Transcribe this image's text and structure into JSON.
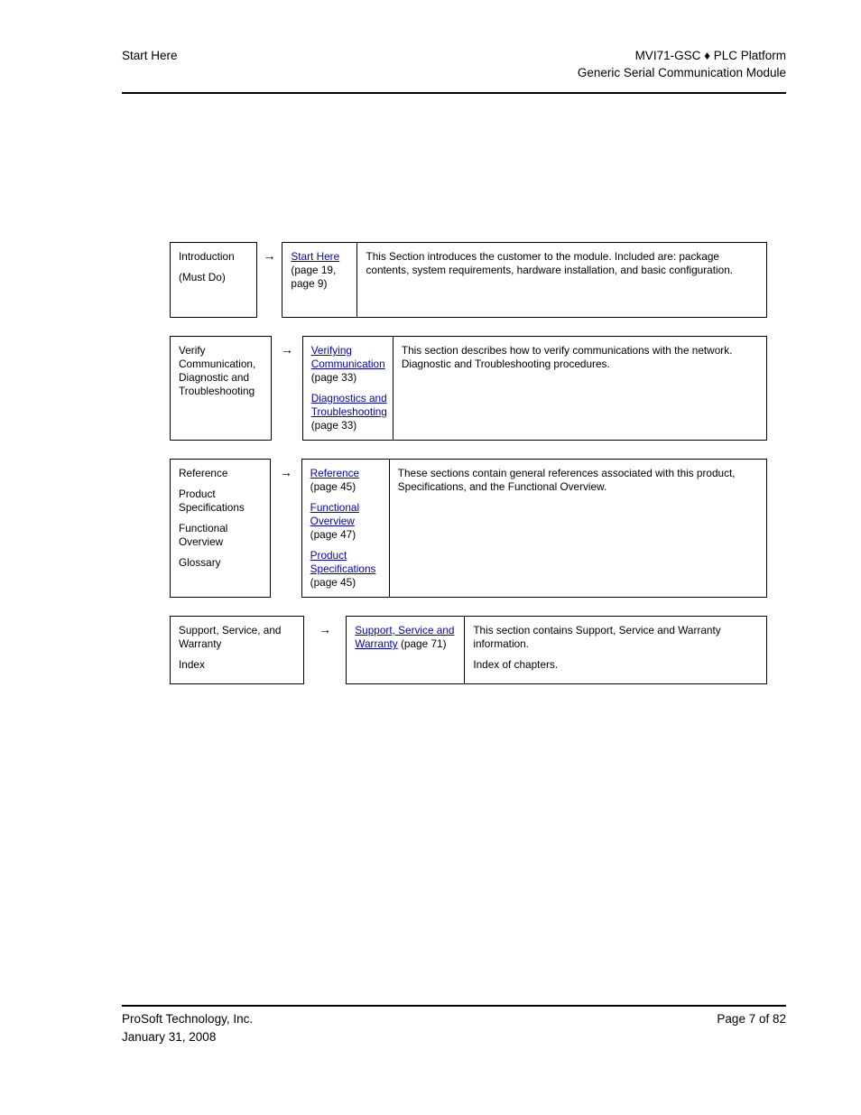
{
  "header": {
    "left_title": "Start Here",
    "right_line1": "MVI71-GSC ♦ PLC Platform",
    "right_line2": "Generic Serial Communication Module"
  },
  "footer": {
    "company": "ProSoft Technology, Inc.",
    "date": "January 31, 2008",
    "page_label": "Page 7 of 82"
  },
  "arrow_glyph": "→",
  "link_color": "#0000C8",
  "flow_rows": [
    {
      "left_items": [
        "Introduction",
        "(Must Do)"
      ],
      "links": [
        {
          "text": "Start Here",
          "suffix": " (page 19, page 9)"
        }
      ],
      "description": [
        "This Section introduces the customer to the module. Included are: package contents, system requirements, hardware installation, and basic configuration."
      ]
    },
    {
      "left_items": [
        "Verify Communication, Diagnostic and Troubleshooting"
      ],
      "links": [
        {
          "text": "Verifying Communication",
          "suffix": " (page 33)"
        },
        {
          "text": "Diagnostics and Troubleshooting",
          "suffix": " (page 33)"
        }
      ],
      "description": [
        "This section describes how to verify communications with the network. Diagnostic and Troubleshooting procedures."
      ]
    },
    {
      "left_items": [
        "Reference",
        "Product Specifications",
        "Functional Overview",
        "Glossary"
      ],
      "links": [
        {
          "text": "Reference",
          "suffix": " (page 45)"
        },
        {
          "text": "Functional Overview",
          "suffix": " (page 47)"
        },
        {
          "text": "Product Specifications",
          "suffix": " (page 45)"
        }
      ],
      "description": [
        "These sections contain general references associated with this product, Specifications, and the Functional Overview."
      ]
    },
    {
      "left_items": [
        "Support, Service, and Warranty",
        "Index"
      ],
      "links": [
        {
          "text": "Support, Service and Warranty",
          "suffix": " (page 71)"
        }
      ],
      "description": [
        "This section contains Support, Service and Warranty information.",
        "Index of chapters."
      ]
    }
  ]
}
